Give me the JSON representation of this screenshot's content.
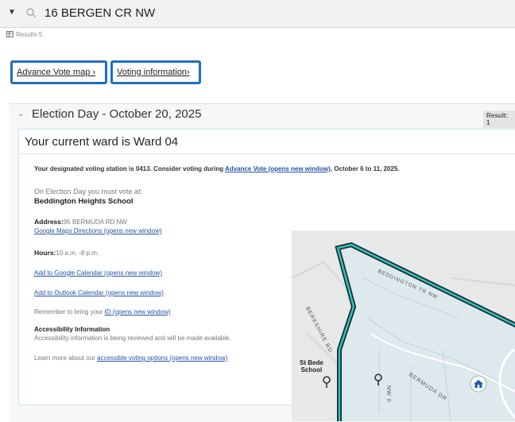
{
  "search": {
    "address": "16 BERGEN CR NW"
  },
  "results": {
    "label": "Results 5"
  },
  "links": {
    "advance_vote_map": "Advance Vote map ›",
    "voting_information": "Voting information›"
  },
  "election_day": {
    "title": "Election Day - October 20, 2025",
    "result_badge": "Result: 1"
  },
  "card": {
    "ward": "Your current ward is Ward 04",
    "designated_prefix": "Your designated voting station is 0413. Consider voting during ",
    "advance_vote_link": "Advance Vote (opens new window)",
    "designated_suffix": ", October 6 to 11, 2025.",
    "on_election_day": "On Election Day you must vote at:",
    "station_name": "Beddington Heights School",
    "address_label": "Address:",
    "address_value": "95 BERMUDA RD NW",
    "directions_link": "Google Maps Directions (opens new window)",
    "hours_label": "Hours:",
    "hours_value": "10 a.m. -8 p.m.",
    "google_calendar_link": "Add to Google Calendar (opens new window)",
    "outlook_calendar_link": "Add to Outlook Calendar (opens new window)",
    "bring_id_prefix": "Remember to bring your ",
    "bring_id_link": "ID (opens new window)",
    "accessibility_heading": "Accessibility Information",
    "accessibility_text": "Accessibility information is being reviewed and will be made available.",
    "learn_more_prefix": "Learn more about our ",
    "learn_more_link": "accessible voting options (opens new window)"
  },
  "map": {
    "street_beddington": "BEDDINGTON TR NW",
    "street_berkshire": "BERKSHIRE RD",
    "street_bermuda": "BERMUDA DR",
    "street_nw": "NW 0",
    "poi_school_line1": "St Bede",
    "poi_school_line2": "School"
  },
  "colors": {
    "accent_blue": "#1d6fc0",
    "link_blue": "#2453a8",
    "boundary_teal": "#2ec4c4"
  },
  "icons": [
    "chevron-down-icon",
    "search-icon",
    "table-icon",
    "map-pin-icon",
    "school-icon"
  ]
}
